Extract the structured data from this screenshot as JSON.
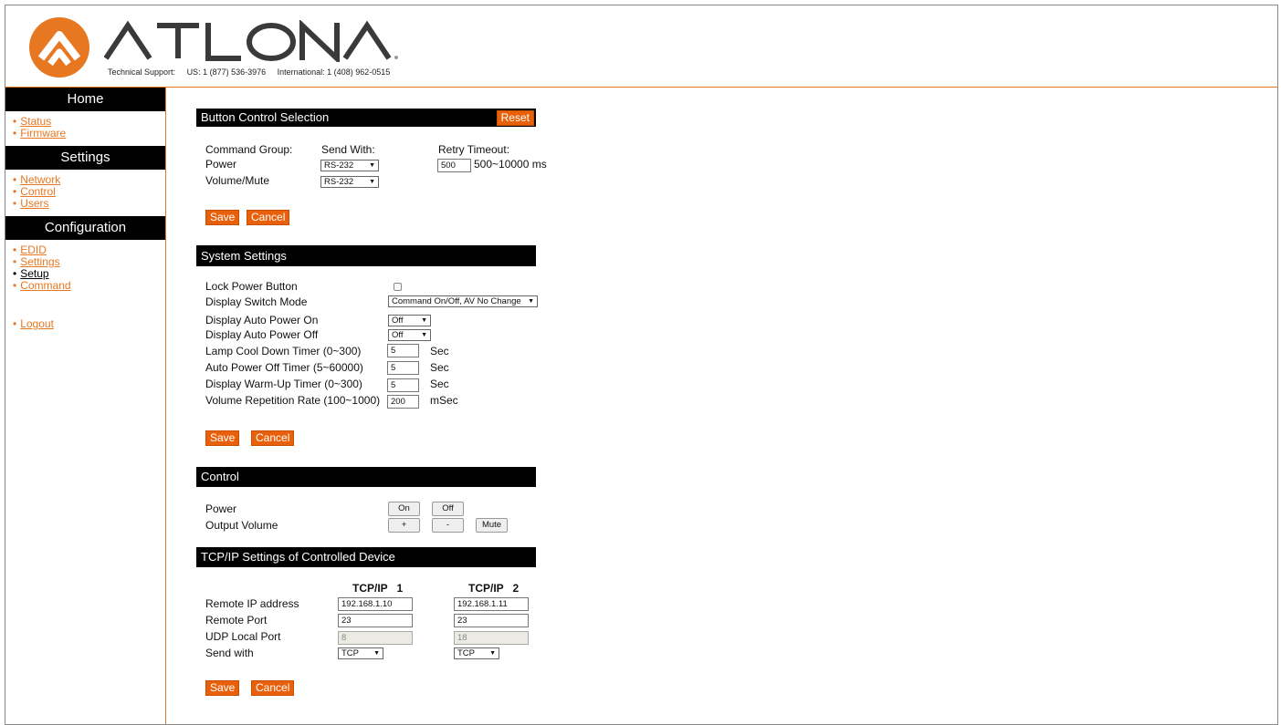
{
  "brand": {
    "name": "ATLONA",
    "support_label": "Technical Support:",
    "support_us": "US: 1 (877) 536-3976",
    "support_intl": "International: 1 (408) 962-0515",
    "accent_color": "#e87722"
  },
  "sidebar": {
    "home": {
      "title": "Home",
      "items": [
        "Status",
        "Firmware"
      ]
    },
    "settings": {
      "title": "Settings",
      "items": [
        "Network",
        "Control",
        "Users"
      ]
    },
    "configuration": {
      "title": "Configuration",
      "items": [
        "EDID",
        "Settings",
        "Setup",
        "Command"
      ],
      "current": "Setup"
    },
    "logout": "Logout"
  },
  "button_control": {
    "title": "Button Control Selection",
    "reset": "Reset",
    "col_group": "Command Group:",
    "col_send": "Send With:",
    "col_retry": "Retry Timeout:",
    "rows": [
      {
        "label": "Power",
        "send": "RS-232"
      },
      {
        "label": "Volume/Mute",
        "send": "RS-232"
      }
    ],
    "retry_value": "500",
    "retry_range": "500~10000 ms",
    "save": "Save",
    "cancel": "Cancel"
  },
  "system_settings": {
    "title": "System Settings",
    "lock_power": "Lock Power Button",
    "display_switch_mode": {
      "label": "Display Switch Mode",
      "value": "Command On/Off, AV No Change"
    },
    "auto_on": {
      "label": "Display Auto Power On",
      "value": "Off"
    },
    "auto_off": {
      "label": "Display Auto Power Off",
      "value": "Off"
    },
    "timers": [
      {
        "label": "Lamp Cool Down Timer (0~300)",
        "value": "5",
        "unit": "Sec"
      },
      {
        "label": "Auto Power Off Timer (5~60000)",
        "value": "5",
        "unit": "Sec"
      },
      {
        "label": "Display Warm-Up Timer (0~300)",
        "value": "5",
        "unit": "Sec"
      },
      {
        "label": "Volume Repetition Rate (100~1000)",
        "value": "200",
        "unit": "mSec"
      }
    ],
    "save": "Save",
    "cancel": "Cancel"
  },
  "control": {
    "title": "Control",
    "power_label": "Power",
    "on": "On",
    "off": "Off",
    "volume_label": "Output Volume",
    "plus": "+",
    "minus": "-",
    "mute": "Mute"
  },
  "tcpip": {
    "title": "TCP/IP Settings of Controlled Device",
    "col1": "TCP/IP   1",
    "col2": "TCP/IP   2",
    "remote_ip_label": "Remote IP address",
    "remote_port_label": "Remote Port",
    "udp_label": "UDP Local Port",
    "send_label": "Send with",
    "ip1": "192.168.1.10",
    "ip2": "192.168.1.11",
    "port1": "23",
    "port2": "23",
    "udp1": "8",
    "udp2": "18",
    "send1": "TCP",
    "send2": "TCP",
    "save": "Save",
    "cancel": "Cancel"
  }
}
